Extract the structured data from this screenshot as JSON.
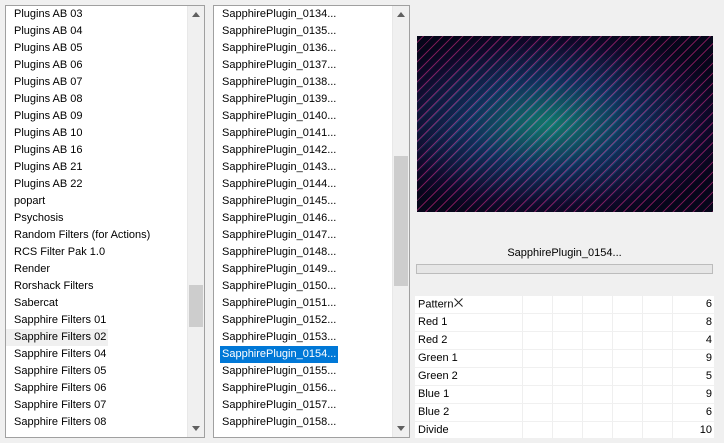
{
  "categories": {
    "items": [
      "Plugins AB 03",
      "Plugins AB 04",
      "Plugins AB 05",
      "Plugins AB 06",
      "Plugins AB 07",
      "Plugins AB 08",
      "Plugins AB 09",
      "Plugins AB 10",
      "Plugins AB 16",
      "Plugins AB 21",
      "Plugins AB 22",
      "popart",
      "Psychosis",
      "Random Filters (for Actions)",
      "RCS Filter Pak 1.0",
      "Render",
      "Rorshack Filters",
      "Sabercat",
      "Sapphire Filters 01",
      "Sapphire Filters 02",
      "Sapphire Filters 04",
      "Sapphire Filters 05",
      "Sapphire Filters 06",
      "Sapphire Filters 07",
      "Sapphire Filters 08"
    ],
    "selected_index": 19
  },
  "filters": {
    "items": [
      "SapphirePlugin_0134...",
      "SapphirePlugin_0135...",
      "SapphirePlugin_0136...",
      "SapphirePlugin_0137...",
      "SapphirePlugin_0138...",
      "SapphirePlugin_0139...",
      "SapphirePlugin_0140...",
      "SapphirePlugin_0141...",
      "SapphirePlugin_0142...",
      "SapphirePlugin_0143...",
      "SapphirePlugin_0144...",
      "SapphirePlugin_0145...",
      "SapphirePlugin_0146...",
      "SapphirePlugin_0147...",
      "SapphirePlugin_0148...",
      "SapphirePlugin_0149...",
      "SapphirePlugin_0150...",
      "SapphirePlugin_0151...",
      "SapphirePlugin_0152...",
      "SapphirePlugin_0153...",
      "SapphirePlugin_0154...",
      "SapphirePlugin_0155...",
      "SapphirePlugin_0156...",
      "SapphirePlugin_0157...",
      "SapphirePlugin_0158..."
    ],
    "selected_index": 20
  },
  "preview": {
    "filter_name": "SapphirePlugin_0154..."
  },
  "params": [
    {
      "name": "Pattern",
      "value": "6"
    },
    {
      "name": "Red 1",
      "value": "8"
    },
    {
      "name": "Red 2",
      "value": "4"
    },
    {
      "name": "Green 1",
      "value": "9"
    },
    {
      "name": "Green 2",
      "value": "5"
    },
    {
      "name": "Blue 1",
      "value": "9"
    },
    {
      "name": "Blue 2",
      "value": "6"
    },
    {
      "name": "Divide",
      "value": "10"
    }
  ],
  "colors": {
    "selection": "#0078d7",
    "panel_bg": "#f0f0f0"
  }
}
